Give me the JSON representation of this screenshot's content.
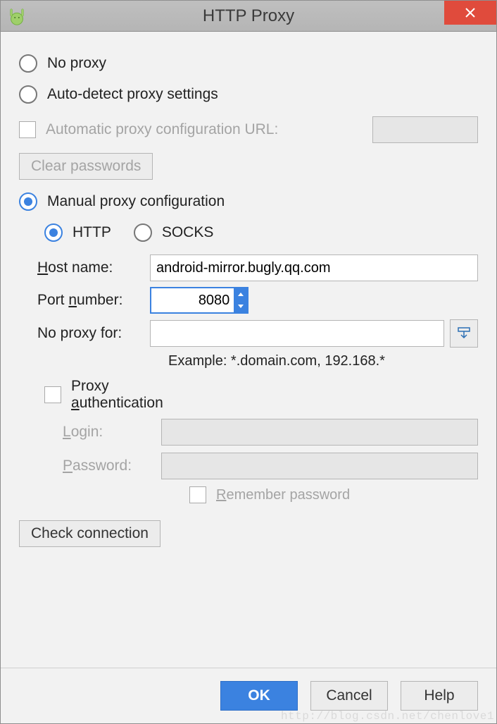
{
  "title": "HTTP Proxy",
  "options": {
    "no_proxy": "No proxy",
    "auto_detect": "Auto-detect proxy settings",
    "auto_config_url": "Automatic proxy configuration URL:",
    "clear_passwords": "Clear passwords",
    "manual": "Manual proxy configuration"
  },
  "manual": {
    "http": "HTTP",
    "socks": "SOCKS",
    "host_label_rest": "ost name:",
    "host_value": "android-mirror.bugly.qq.com",
    "port_label_pre": "Port ",
    "port_label_post": "umber:",
    "port_value": "8080",
    "no_proxy_for": "No proxy for:",
    "example": "Example: *.domain.com, 192.168.*"
  },
  "auth": {
    "label_pre": "Proxy ",
    "label_post": "uthentication",
    "login_rest": "ogin:",
    "password_rest": "assword:",
    "remember_rest": "emember password"
  },
  "buttons": {
    "check_connection": "Check connection",
    "ok": "OK",
    "cancel": "Cancel",
    "help": "Help"
  },
  "watermark": "http://blog.csdn.net/chenlove1"
}
